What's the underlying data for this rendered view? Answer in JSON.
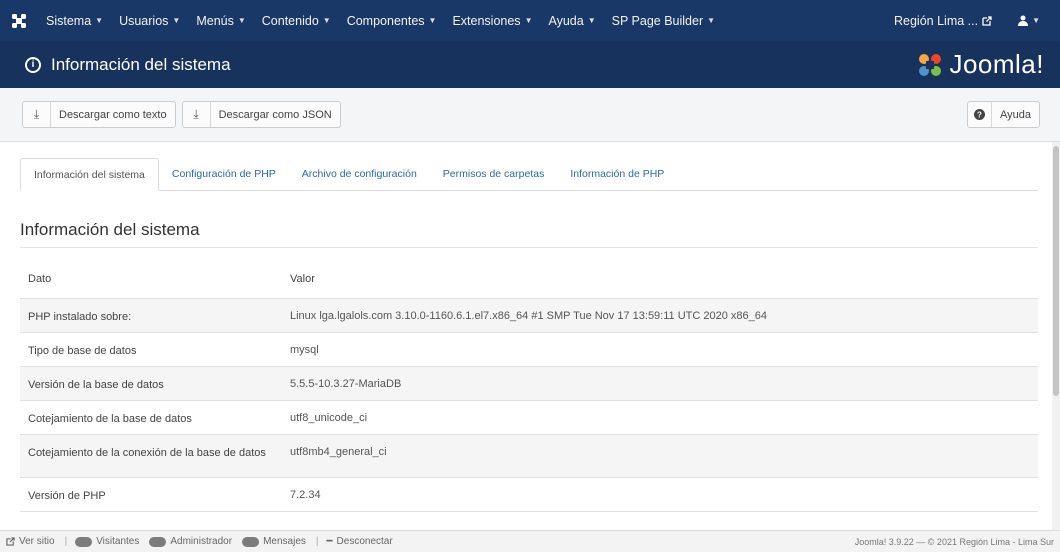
{
  "navbar": {
    "logo_icon": "joomla-icon",
    "menus": [
      {
        "label": "Sistema"
      },
      {
        "label": "Usuarios"
      },
      {
        "label": "Menús"
      },
      {
        "label": "Contenido"
      },
      {
        "label": "Componentes"
      },
      {
        "label": "Extensiones"
      },
      {
        "label": "Ayuda"
      },
      {
        "label": "SP Page Builder"
      }
    ],
    "site_label": "Región Lima ...",
    "external_icon": "external-link-icon",
    "user_icon": "user-icon"
  },
  "header": {
    "icon": "info-circle-icon",
    "title": "Información del sistema",
    "brand": "Joomla!"
  },
  "toolbar": {
    "download_text_label": "Descargar como texto",
    "download_json_label": "Descargar como JSON",
    "help_label": "Ayuda"
  },
  "tabs": [
    {
      "label": "Información del sistema",
      "active": true
    },
    {
      "label": "Configuración de PHP",
      "active": false
    },
    {
      "label": "Archivo de configuración",
      "active": false
    },
    {
      "label": "Permisos de carpetas",
      "active": false
    },
    {
      "label": "Información de PHP",
      "active": false
    }
  ],
  "section_title": "Información del sistema",
  "table": {
    "headers": {
      "key": "Dato",
      "value": "Valor"
    },
    "rows": [
      {
        "key": "PHP instalado sobre:",
        "value": "Linux lga.lgalols.com 3.10.0-1160.6.1.el7.x86_64 #1 SMP Tue Nov 17 13:59:11 UTC 2020 x86_64"
      },
      {
        "key": "Tipo de base de datos",
        "value": "mysql"
      },
      {
        "key": "Versión de la base de datos",
        "value": "5.5.5-10.3.27-MariaDB"
      },
      {
        "key": "Cotejamiento de la base de datos",
        "value": "utf8_unicode_ci"
      },
      {
        "key": "Cotejamiento de la conexión de la base de datos",
        "value": "utf8mb4_general_ci"
      },
      {
        "key": "Versión de PHP",
        "value": "7.2.34"
      }
    ]
  },
  "statusbar": {
    "view_site": "Ver sitio",
    "visitors": "Visitantes",
    "admin": "Administrador",
    "messages": "Mensajes",
    "logout": "Desconectar",
    "footer": "Joomla! 3.9.22 — © 2021 Región Lima - Lima Sur"
  },
  "colors": {
    "navbar_bg": "#1a3867",
    "header_bg": "#17325d",
    "link": "#2a6aa8"
  }
}
